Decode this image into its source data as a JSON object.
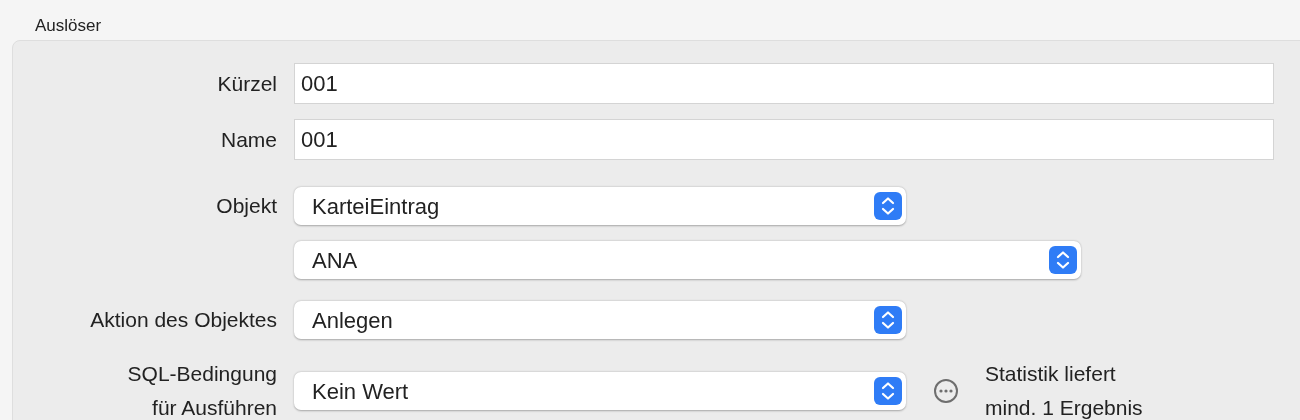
{
  "group": {
    "title": "Auslöser"
  },
  "rows": [
    {
      "kind": "text",
      "label": "Kürzel",
      "value": "001"
    },
    {
      "kind": "text",
      "label": "Name",
      "value": "001"
    },
    {
      "kind": "popup",
      "label": "Objekt",
      "value": "KarteiEintrag"
    },
    {
      "kind": "popup",
      "value": "ANA"
    },
    {
      "kind": "popup",
      "label": "Aktion des Objektes",
      "value": "Anlegen"
    },
    {
      "kind": "popup",
      "label": "SQL-Bedingung\nfür Ausführen",
      "value": "Kein Wert",
      "note": "Statistik liefert\nmind. 1 Ergebnis"
    }
  ]
}
